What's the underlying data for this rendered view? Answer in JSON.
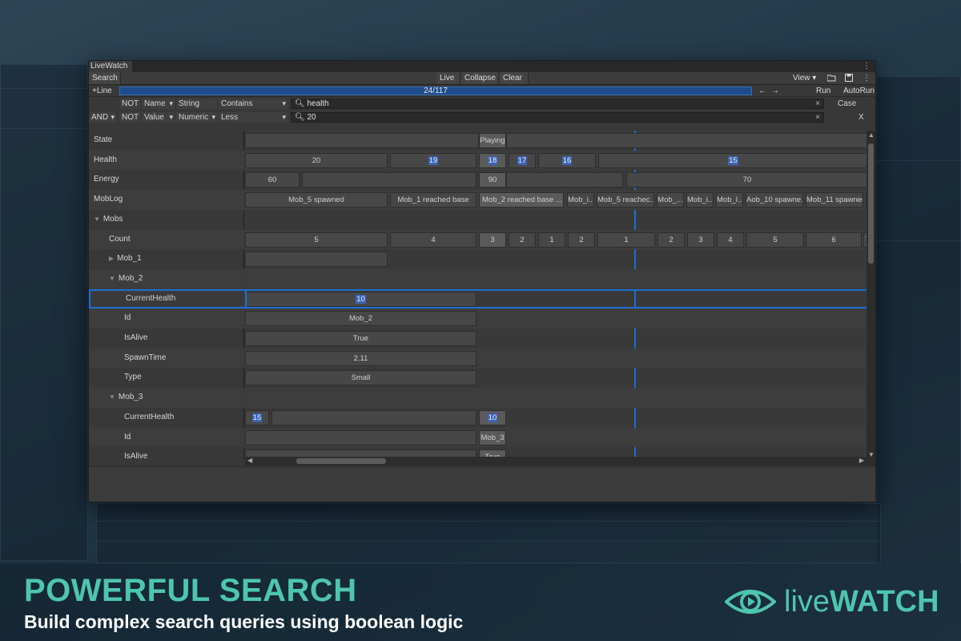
{
  "window": {
    "title": "LiveWatch",
    "menu_label": "⋮"
  },
  "toolbar": {
    "search_label": "Search",
    "live_label": "Live",
    "collapse_label": "Collapse",
    "clear_label": "Clear",
    "view_label": "View ▾",
    "more_label": "⋮"
  },
  "progress": {
    "add_line_label": "+Line",
    "text": "24/117",
    "fraction": 0.205,
    "prev_label": "←",
    "next_label": "→",
    "run_label": "Run",
    "autorun_label": "AutoRun"
  },
  "query": {
    "row1": {
      "not": "NOT",
      "field": "Name",
      "type": "String",
      "op": "Contains",
      "value": "health",
      "clear": "×"
    },
    "row2": {
      "logic": "AND",
      "not": "NOT",
      "field": "Value",
      "type": "Numeric",
      "op": "Less",
      "value": "20",
      "clear": "×"
    },
    "case_label": "Case",
    "close_label": "X"
  },
  "rows": [
    {
      "label": "State",
      "indent": 0
    },
    {
      "label": "Health",
      "indent": 0
    },
    {
      "label": "Energy",
      "indent": 0
    },
    {
      "label": "MobLog",
      "indent": 0
    },
    {
      "label": "Mobs",
      "indent": 0,
      "tri": "▼"
    },
    {
      "label": "Count",
      "indent": 1
    },
    {
      "label": "Mob_1",
      "indent": 1,
      "tri": "▶"
    },
    {
      "label": "Mob_2",
      "indent": 1,
      "tri": "▼"
    },
    {
      "label": "CurrentHealth",
      "indent": 2
    },
    {
      "label": "Id",
      "indent": 2
    },
    {
      "label": "IsAlive",
      "indent": 2
    },
    {
      "label": "SpawnTime",
      "indent": 2
    },
    {
      "label": "Type",
      "indent": 2
    },
    {
      "label": "Mob_3",
      "indent": 1,
      "tri": "▼"
    },
    {
      "label": "CurrentHealth",
      "indent": 2
    },
    {
      "label": "Id",
      "indent": 2
    },
    {
      "label": "IsAlive",
      "indent": 2
    }
  ],
  "cells": {
    "state": [
      "Playing"
    ],
    "health": [
      "20",
      "19",
      "18",
      "17",
      "16",
      "15"
    ],
    "energy": [
      "60",
      "90",
      "70"
    ],
    "moblog": [
      "Mob_5 spawned",
      "Mob_1 reached base",
      "Mob_2 reached base",
      "...",
      "Mob_i...",
      "Mob_5 reachec...",
      "Mob_...",
      "Mob_i...",
      "Mob_l...",
      "Aob_10 spawne...",
      "Mob_11 spawnec..",
      "s"
    ],
    "count": [
      "5",
      "4",
      "3",
      "2",
      "1",
      "2",
      "1",
      "2",
      "3",
      "4",
      "5",
      "6",
      "7"
    ],
    "mob2_current": [
      "10"
    ],
    "mob2_id": [
      "Mob_2"
    ],
    "mob2_alive": [
      "True"
    ],
    "mob2_spawn": [
      "2.11"
    ],
    "mob2_type": [
      "Small"
    ],
    "mob3_current": [
      "15",
      "10"
    ],
    "mob3_id": [
      "Mob_3"
    ],
    "mob3_alive": [
      "True"
    ]
  },
  "banner": {
    "headline": "POWERFUL SEARCH",
    "subline": "Build complex search queries using boolean logic",
    "logo_live": "live",
    "logo_watch": "WATCH"
  },
  "colors": {
    "accent": "#4ec5b0",
    "selection": "#1d6fd6",
    "highlight": "#3c64b4"
  }
}
